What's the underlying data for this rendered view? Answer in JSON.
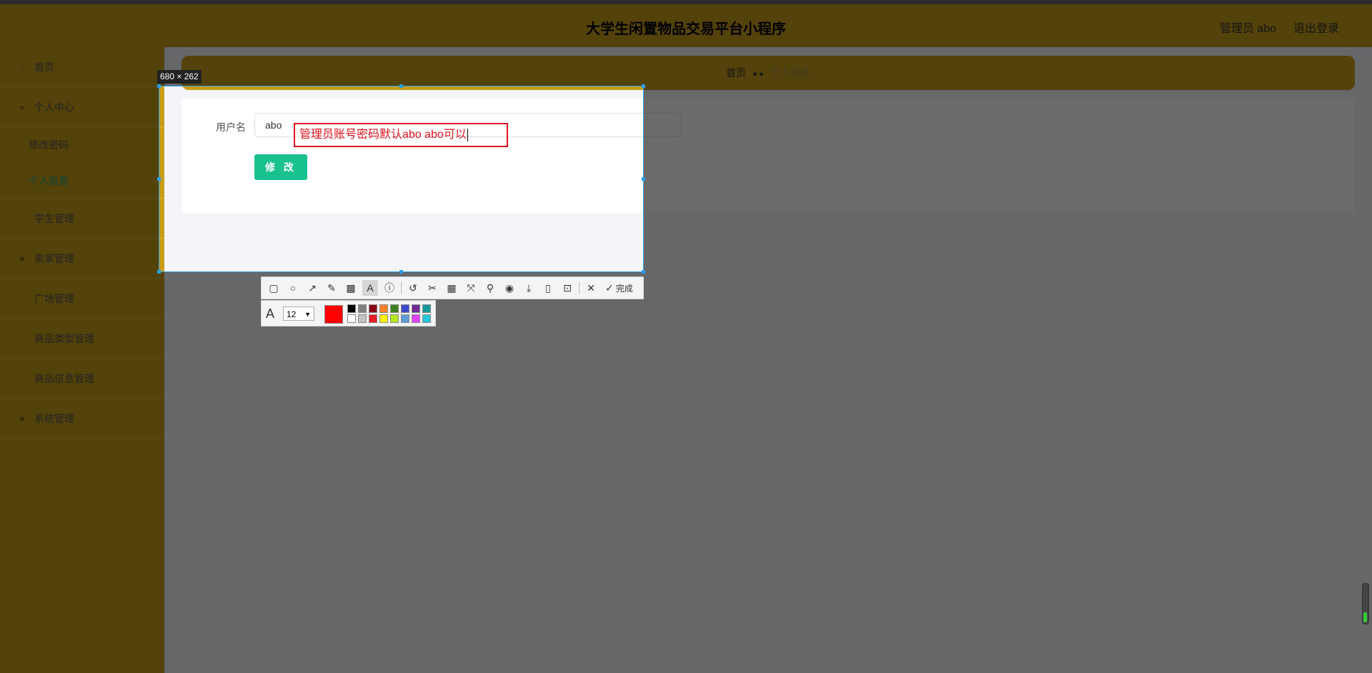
{
  "header": {
    "title": "大学生闲置物品交易平台小程序",
    "user": "管理员 abo",
    "logout": "退出登录"
  },
  "sidebar": {
    "items": [
      {
        "label": "首页",
        "icon": "home-icon"
      },
      {
        "label": "个人中心",
        "icon": "user-icon"
      },
      {
        "label": "学生管理",
        "icon": "student-icon"
      },
      {
        "label": "卖家管理",
        "icon": "seller-icon"
      },
      {
        "label": "广场管理",
        "icon": "square-icon"
      },
      {
        "label": "商品类型管理",
        "icon": "category-icon"
      },
      {
        "label": "商品信息管理",
        "icon": "goods-icon"
      },
      {
        "label": "系统管理",
        "icon": "system-icon"
      }
    ],
    "sub_items": [
      {
        "label": "修改密码"
      },
      {
        "label": "个人信息"
      }
    ]
  },
  "breadcrumb": {
    "home": "首页",
    "separator": "★★",
    "current": "个人信息"
  },
  "form": {
    "username_label": "用户名",
    "username_value": "abo",
    "submit_label": "修 改"
  },
  "capture": {
    "size_label": "680 × 262",
    "annotation_text": "管理员账号密码默认abo abo可以",
    "done_label": "完成",
    "font_size": "12",
    "current_color": "#ff0000",
    "palette": [
      "#000000",
      "#7f7f7f",
      "#880015",
      "#ff7f27",
      "#3f7f1f",
      "#3f48cc",
      "#6f2a96",
      "#139a9a",
      "#ffffff",
      "#c3c3c3",
      "#ed1c24",
      "#fff200",
      "#b5e61d",
      "#5b9bd5",
      "#e040fb",
      "#26c6da"
    ]
  }
}
